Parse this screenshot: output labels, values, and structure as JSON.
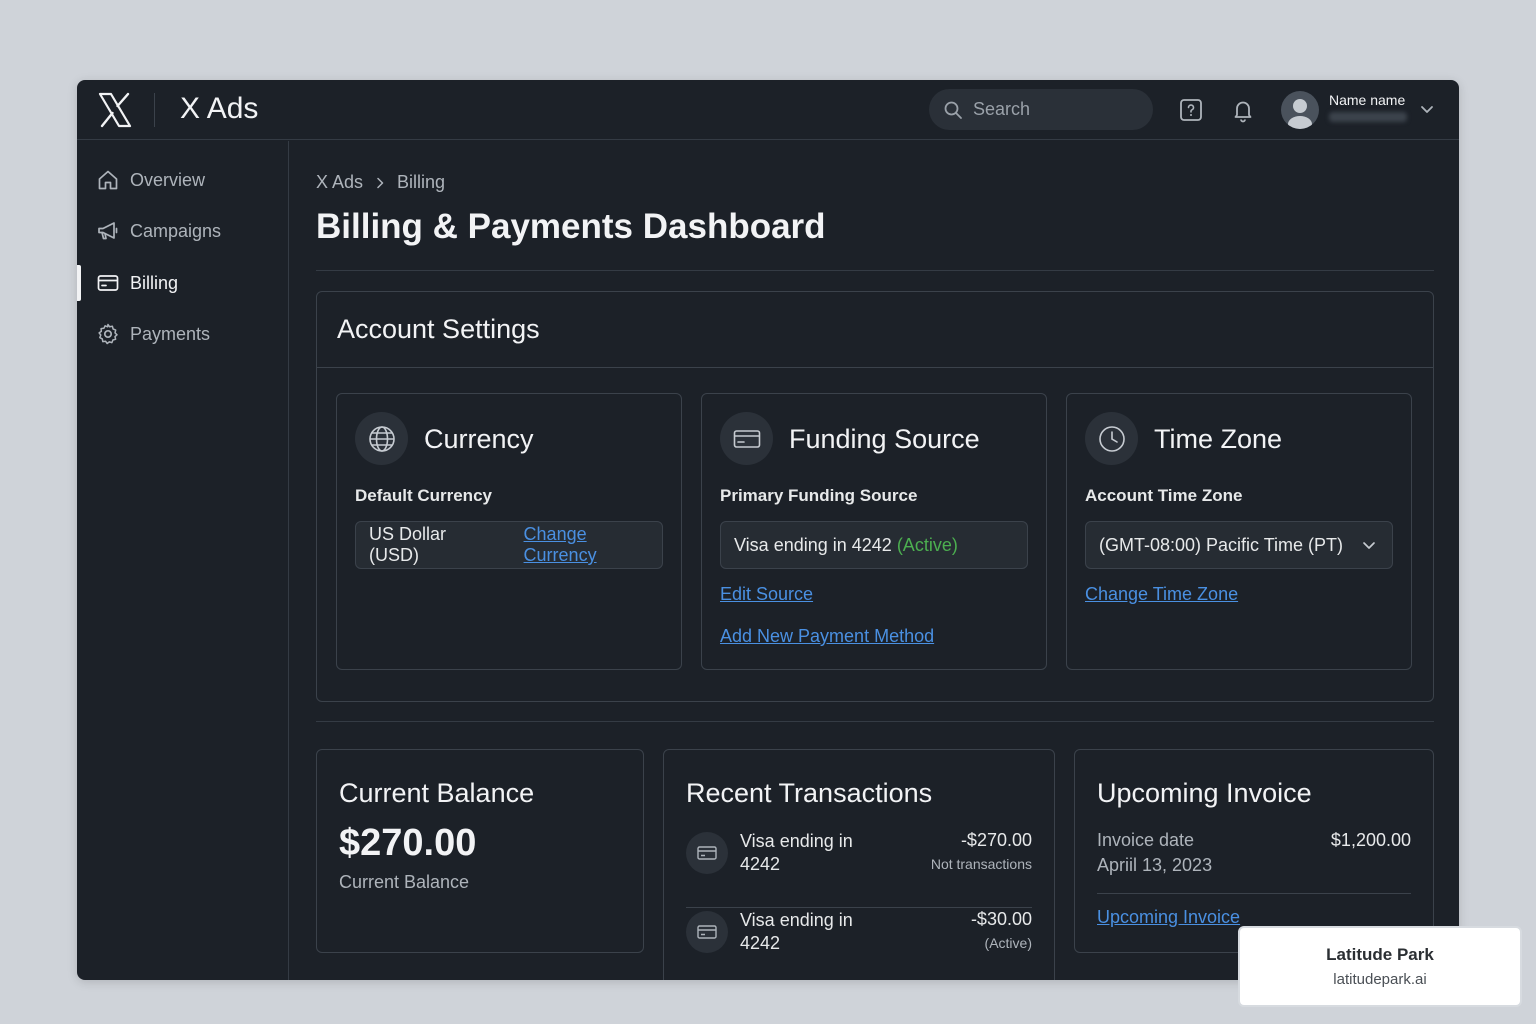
{
  "app": {
    "title": "X Ads"
  },
  "topbar": {
    "search_placeholder": "Search",
    "user_name": "Name name"
  },
  "sidebar": {
    "items": [
      {
        "label": "Overview",
        "icon": "home-icon"
      },
      {
        "label": "Campaigns",
        "icon": "megaphone-icon"
      },
      {
        "label": "Billing",
        "icon": "credit-card-icon",
        "active": true
      },
      {
        "label": "Payments",
        "icon": "gear-icon"
      }
    ]
  },
  "breadcrumb": {
    "root": "X Ads",
    "current": "Billing"
  },
  "page": {
    "title": "Billing & Payments Dashboard"
  },
  "account_settings": {
    "title": "Account Settings",
    "currency": {
      "title": "Currency",
      "label": "Default Currency",
      "value": "US Dollar (USD)",
      "action": "Change Currency"
    },
    "funding": {
      "title": "Funding Source",
      "label": "Primary Funding Source",
      "value": "Visa ending in 4242",
      "status": "(Active)",
      "edit": "Edit Source",
      "add": "Add New Payment Method"
    },
    "timezone": {
      "title": "Time Zone",
      "label": "Account Time Zone",
      "value": "(GMT-08:00) Pacific Time (PT)",
      "action": "Change Time Zone"
    }
  },
  "balance": {
    "title": "Current Balance",
    "amount": "$270.00",
    "label": "Current Balance"
  },
  "transactions": {
    "title": "Recent Transactions",
    "items": [
      {
        "desc": "Visa ending in 4242",
        "amount": "-$270.00",
        "sub": "Not transactions"
      },
      {
        "desc": "Visa ending in 4242",
        "amount": "-$30.00",
        "sub": "(Active)"
      }
    ]
  },
  "invoice": {
    "title": "Upcoming Invoice",
    "date_label": "Invoice date",
    "date": "Apriil 13, 2023",
    "amount": "$1,200.00",
    "link": "Upcoming Invoice"
  },
  "watermark": {
    "name": "Latitude Park",
    "url": "latitudepark.ai"
  },
  "colors": {
    "background": "#cfd3d9",
    "window": "#1c2128",
    "link": "#4a90e2",
    "active": "#4caf50"
  }
}
